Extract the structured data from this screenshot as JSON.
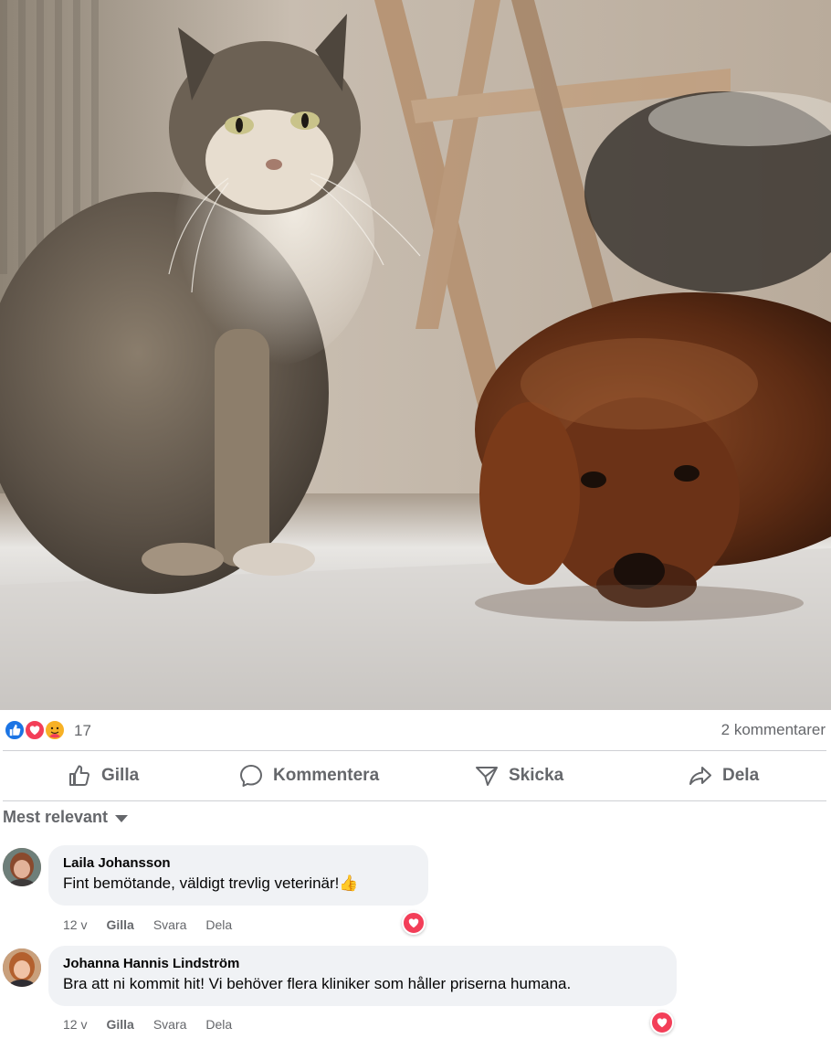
{
  "post": {
    "photo_alt": "",
    "reaction_icons": [
      "like-icon",
      "love-icon",
      "care-icon"
    ],
    "reaction_count": "17",
    "comment_count_label": "2 kommentarer"
  },
  "actions": {
    "like_label": "Gilla",
    "comment_label": "Kommentera",
    "send_label": "Skicka",
    "share_label": "Dela"
  },
  "sort": {
    "label": "Mest relevant"
  },
  "comments": [
    {
      "author": "Laila Johansson",
      "text": "Fint bemötande, väldigt trevlig veterinär!👍",
      "time": "12 v",
      "like_label": "Gilla",
      "reply_label": "Svara",
      "share_label": "Dela",
      "reaction": "love-icon"
    },
    {
      "author": "Johanna Hannis Lindström",
      "text": "Bra att ni kommit hit! Vi behöver flera kliniker som håller priserna humana.",
      "time": "12 v",
      "like_label": "Gilla",
      "reply_label": "Svara",
      "share_label": "Dela",
      "reaction": "love-icon"
    }
  ],
  "colors": {
    "like_blue": "#1b74e4",
    "love_red": "#f33e58",
    "care_yellow": "#f7b125",
    "secondary_text": "#65676b",
    "bubble_bg": "#f0f2f5"
  }
}
